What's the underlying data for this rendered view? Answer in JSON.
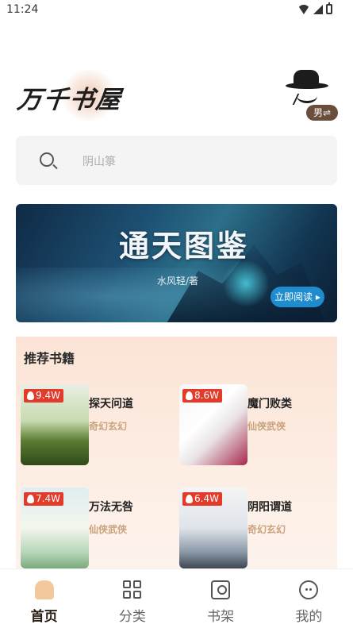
{
  "status_bar": {
    "time": "11:24"
  },
  "header": {
    "logo_text": "万千书屋",
    "gender_toggle": "男⇌"
  },
  "search": {
    "placeholder": "阴山箓"
  },
  "banner": {
    "title": "通天图鉴",
    "author": "水风轻/著",
    "button_label": "立即阅读 ▸"
  },
  "recommend": {
    "title": "推荐书籍",
    "books": [
      {
        "heat": "9.4W",
        "name": "探天问道",
        "genre": "奇幻玄幻"
      },
      {
        "heat": "8.6W",
        "name": "魔门败类",
        "genre": "仙侠武侠"
      },
      {
        "heat": "7.4W",
        "name": "万法无咎",
        "genre": "仙侠武侠"
      },
      {
        "heat": "6.4W",
        "name": "阴阳谓道",
        "genre": "奇幻玄幻"
      }
    ]
  },
  "nav": {
    "items": [
      {
        "label": "首页",
        "icon": "home-icon",
        "active": true
      },
      {
        "label": "分类",
        "icon": "category-icon"
      },
      {
        "label": "书架",
        "icon": "bookshelf-icon"
      },
      {
        "label": "我的",
        "icon": "profile-icon"
      }
    ]
  },
  "colors": {
    "accent": "#f3c89c",
    "heat_badge": "#e43a2a",
    "banner_button": "#1e8ccf",
    "genre_text": "#c9a27e"
  }
}
